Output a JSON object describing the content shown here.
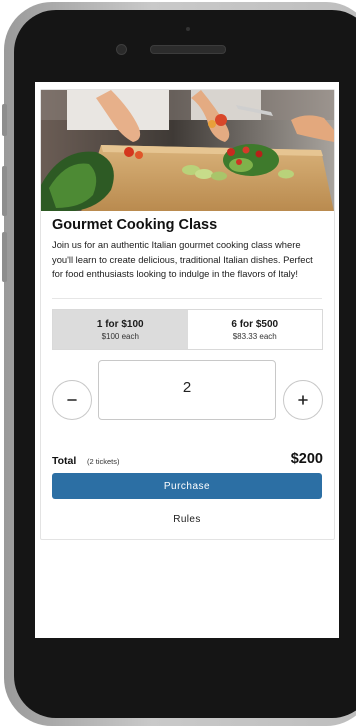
{
  "product": {
    "title": "Gourmet Cooking Class",
    "description": "Join us for an authentic Italian gourmet cooking class where you'll learn to create delicious, traditional Italian dishes. Perfect for food enthusiasts looking to indulge in the flavors of Italy!",
    "image_subject": "chef hands cutting vegetables on a cutting board"
  },
  "pricing_options": [
    {
      "label": "1 for $100",
      "sub": "$100 each",
      "selected": true
    },
    {
      "label": "6 for $500",
      "sub": "$83.33 each",
      "selected": false
    }
  ],
  "quantity": {
    "value": "2",
    "decrement_icon": "minus-icon",
    "increment_icon": "plus-icon"
  },
  "total": {
    "label": "Total",
    "count": "(2 tickets)",
    "amount": "$200"
  },
  "actions": {
    "purchase_label": "Purchase",
    "rules_label": "Rules"
  },
  "colors": {
    "primary_button": "#2c6fa4",
    "selected_option": "#dcdcdc"
  }
}
